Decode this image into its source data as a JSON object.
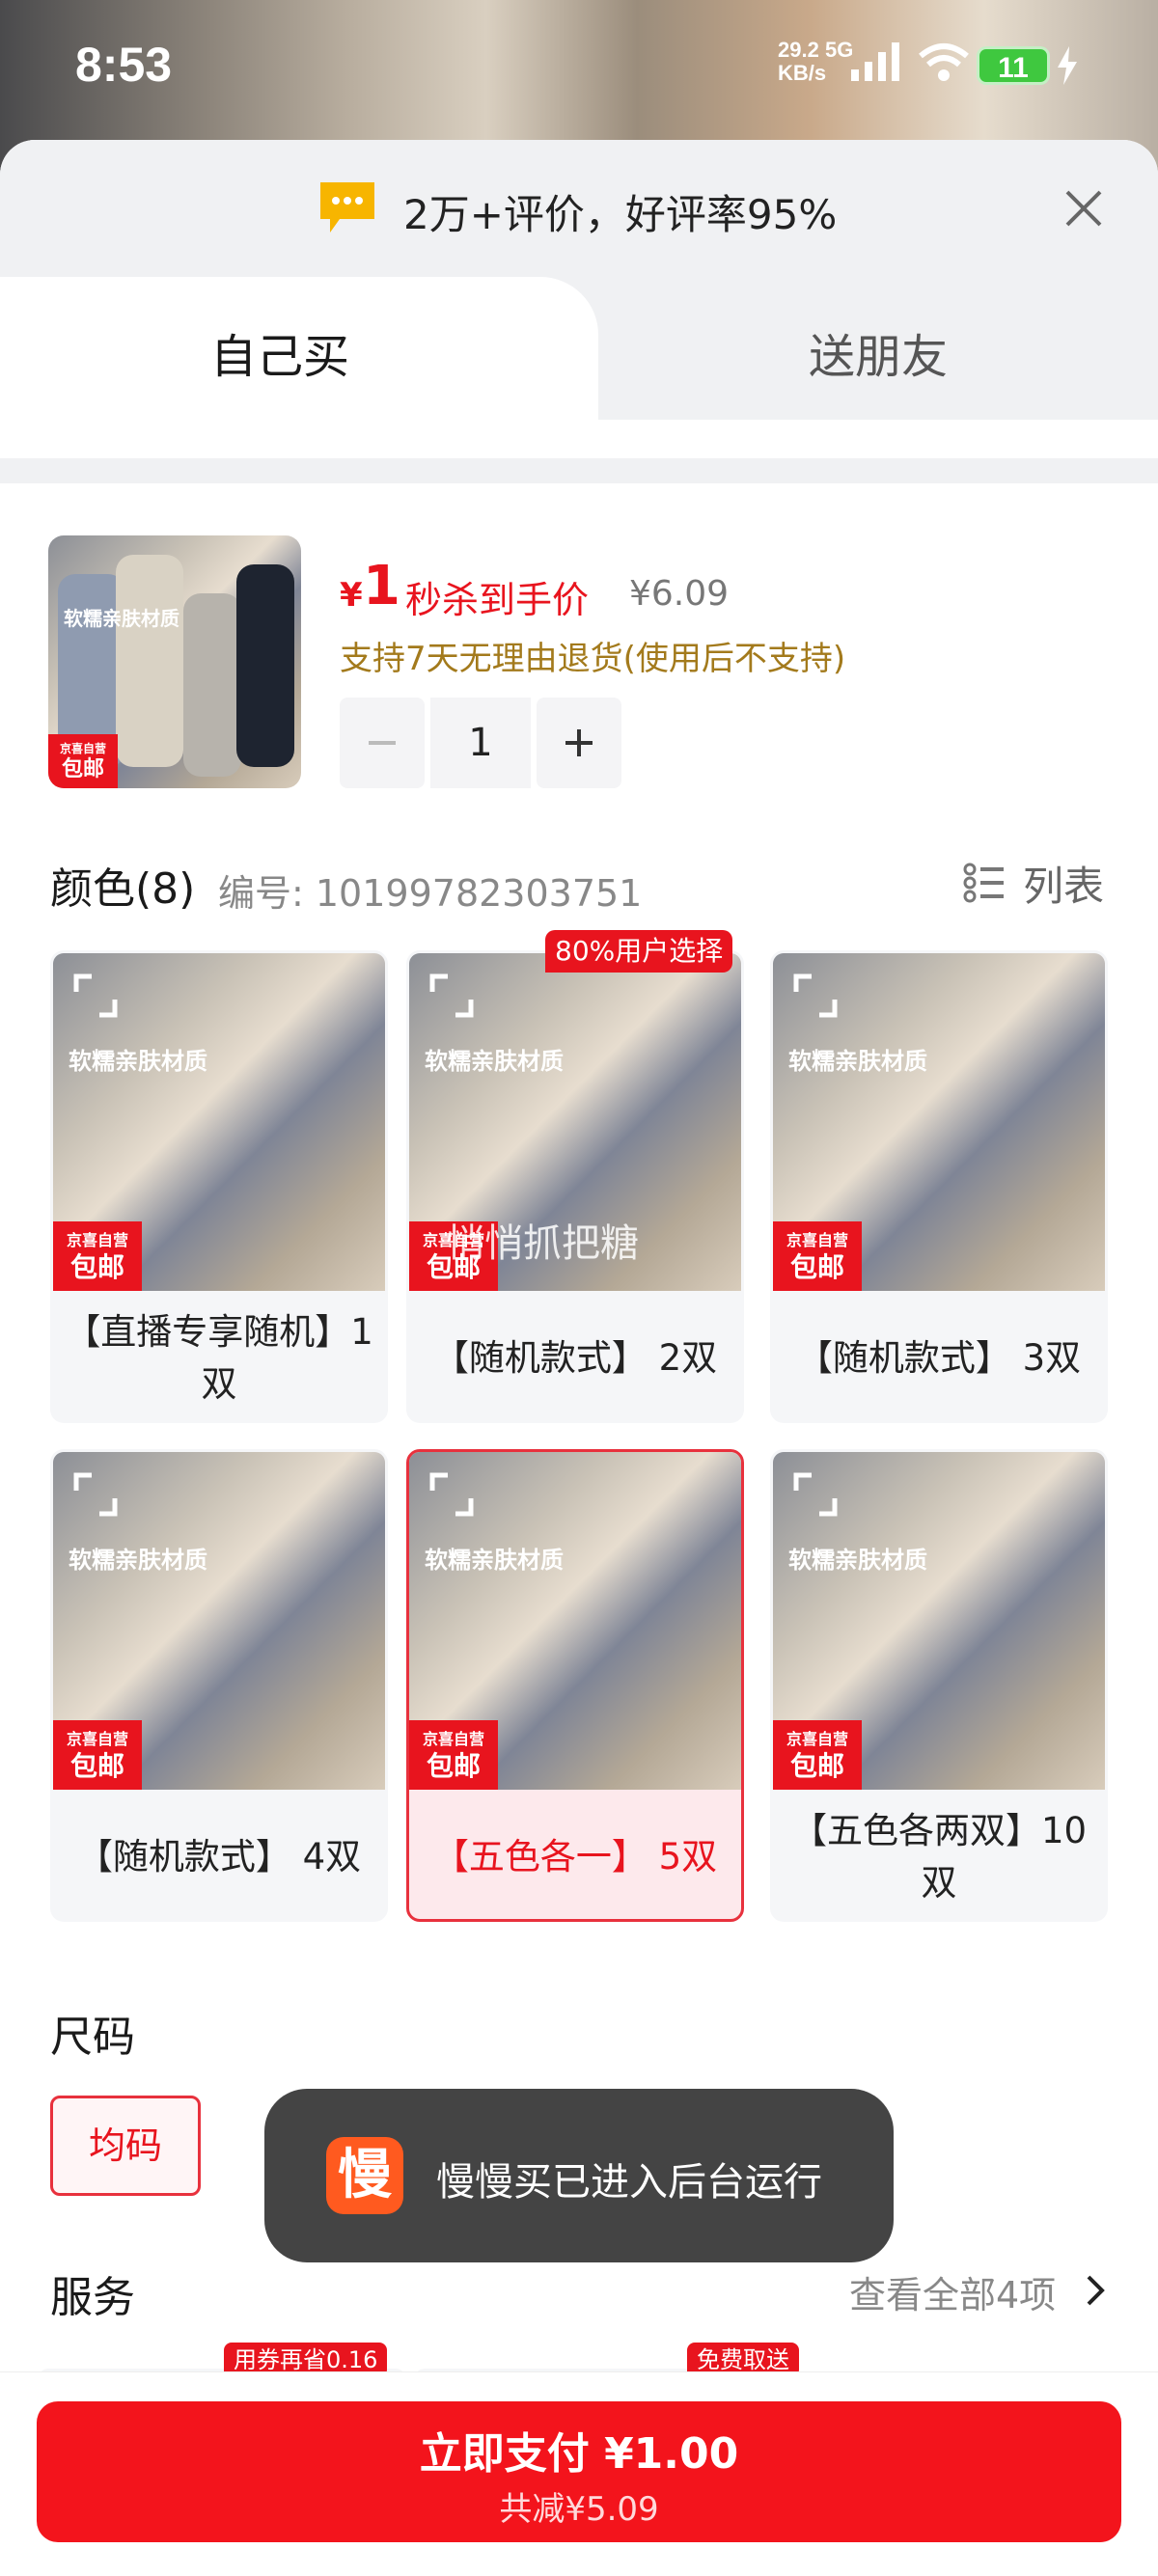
{
  "status_bar": {
    "time": "8:53",
    "net_speed": "29.2",
    "net_unit": "KB/s",
    "net_type": "5G",
    "battery": "11"
  },
  "sheet": {
    "review_summary": "2万+评价，好评率95%",
    "tabs": [
      {
        "label": "自己买",
        "selected": true
      },
      {
        "label": "送朋友",
        "selected": false
      }
    ]
  },
  "product": {
    "thumb_caption": "软糯亲肤材质",
    "price_symbol": "¥",
    "price": "1",
    "price_label": "秒杀到手价",
    "original_price": "¥6.09",
    "return_policy": "支持7天无理由退货(使用后不支持)",
    "quantity": "1",
    "badge_top": "京喜自营",
    "badge_bottom": "包邮"
  },
  "color": {
    "title": "颜色(8)",
    "code_label": "编号: 10199782303751",
    "list_label": "列表",
    "hot_badge": "80%用户选择",
    "watermark": "悄悄抓把糖",
    "options": [
      {
        "label": "【直播专享随机】1双",
        "selected": false
      },
      {
        "label": "【随机款式】 2双",
        "selected": false
      },
      {
        "label": "【随机款式】 3双",
        "selected": false
      },
      {
        "label": "【随机款式】 4双",
        "selected": false
      },
      {
        "label": "【五色各一】 5双",
        "selected": true
      },
      {
        "label": "【五色各两双】10双",
        "selected": false
      }
    ]
  },
  "size": {
    "title": "尺码",
    "options": [
      {
        "label": "均码",
        "selected": true
      }
    ]
  },
  "toast": {
    "icon_char": "慢",
    "text": "慢慢买已进入后台运行"
  },
  "service": {
    "title": "服务",
    "view_all": "查看全部4项",
    "badges": [
      "用券再省0.16",
      "免费取送"
    ]
  },
  "footer": {
    "pay_label": "立即支付 ¥1.00",
    "saving_label": "共减¥5.09"
  },
  "colors": {
    "accent": "#e8141e",
    "gold_text": "#a37a1c",
    "selected_bg": "#fde9ec"
  }
}
